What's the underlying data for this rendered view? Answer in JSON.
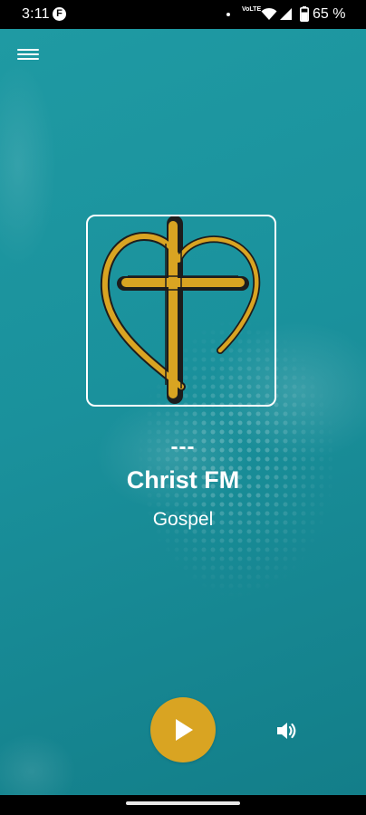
{
  "status_bar": {
    "time": "3:11",
    "app_icon_letter": "F",
    "volte_line1": "VoLTE",
    "battery_text": "65 %",
    "icons": [
      "notification-dot-icon",
      "volte-icon",
      "wifi-icon",
      "signal-icon",
      "battery-icon"
    ]
  },
  "header": {
    "menu_icon": "hamburger-menu-icon"
  },
  "player": {
    "track_text": "---",
    "station_name": "Christ FM",
    "genre": "Gospel",
    "artwork": "heart-cross-logo",
    "play_icon": "play-icon",
    "volume_icon": "volume-icon"
  },
  "colors": {
    "background_teal": "#1a919c",
    "accent_gold": "#d9a422",
    "text": "#ffffff"
  }
}
